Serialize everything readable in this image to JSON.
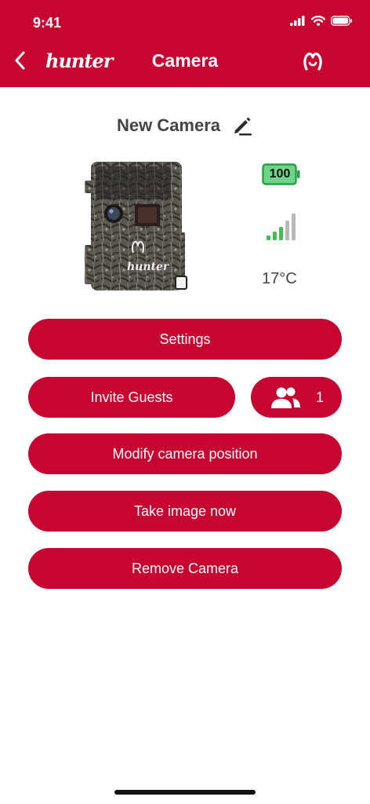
{
  "status": {
    "time": "9:41"
  },
  "header": {
    "brand": "hunter",
    "title": "Camera"
  },
  "camera": {
    "name": "New Camera",
    "battery": "100",
    "temperature": "17°C",
    "guest_count": "1"
  },
  "actions": {
    "settings": "Settings",
    "invite_guests": "Invite Guests",
    "modify_position": "Modify camera position",
    "take_image": "Take image now",
    "remove_camera": "Remove Camera"
  },
  "colors": {
    "brand_red": "#c60530",
    "battery_green": "#3dbb5c",
    "signal_green": "#44bb55",
    "signal_gray": "#b8b8b8"
  },
  "icons": [
    "back-chevron-icon",
    "hunter-logo",
    "brand-mark-icon",
    "edit-pencil-icon",
    "battery-icon",
    "signal-bars-icon",
    "guests-icon"
  ]
}
